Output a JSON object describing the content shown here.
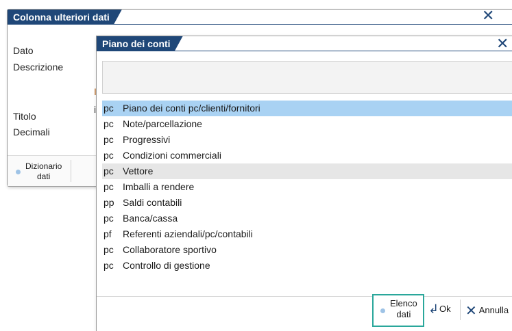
{
  "back_window": {
    "title": "Colonna ulteriori dati",
    "labels": {
      "dato": "Dato",
      "descrizione": "Descrizione",
      "titolo": "Titolo",
      "decimali": "Decimali"
    },
    "footer_button_line1": "Dizionario",
    "footer_button_line2": "dati",
    "stray_chars": [
      "I",
      "i"
    ]
  },
  "front_window": {
    "title": "Piano dei conti",
    "search_value": "",
    "items": [
      {
        "code": "pc",
        "label": "Piano dei conti pc/clienti/fornitori"
      },
      {
        "code": "pc",
        "label": "Note/parcellazione"
      },
      {
        "code": "pc",
        "label": "Progressivi"
      },
      {
        "code": "pc",
        "label": "Condizioni commerciali"
      },
      {
        "code": "pc",
        "label": "Vettore"
      },
      {
        "code": "pc",
        "label": "Imballi a rendere"
      },
      {
        "code": "pp",
        "label": "Saldi contabili"
      },
      {
        "code": "pc",
        "label": "Banca/cassa"
      },
      {
        "code": "pf",
        "label": "Referenti aziendali/pc/contabili"
      },
      {
        "code": "pc",
        "label": "Collaboratore sportivo"
      },
      {
        "code": "pc",
        "label": "Controllo di gestione"
      }
    ],
    "footer": {
      "elenco_line1": "Elenco",
      "elenco_line2": "dati",
      "ok": "Ok",
      "annulla": "Annulla"
    }
  },
  "colors": {
    "title_bg": "#1f4778",
    "selected_row": "#a9d2f3",
    "highlight_border": "#2aa79b"
  }
}
